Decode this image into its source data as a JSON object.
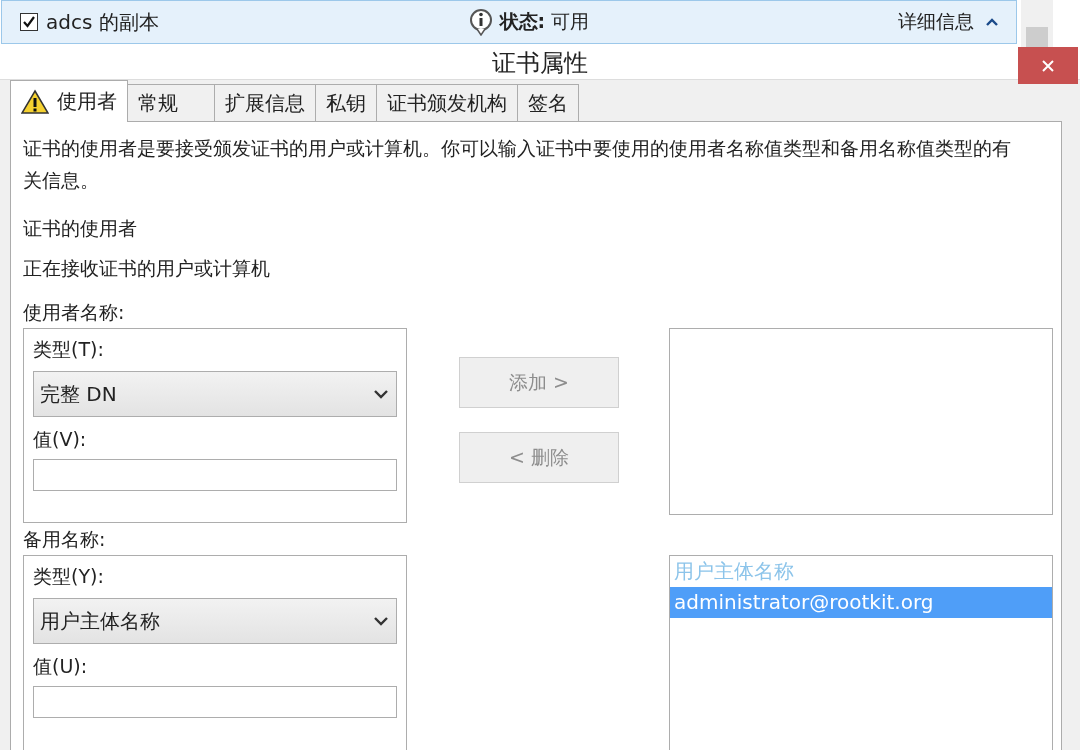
{
  "template_bar": {
    "checked": true,
    "name": "adcs 的副本",
    "status_label": "状态:",
    "status_value": "可用",
    "details": "详细信息"
  },
  "window": {
    "title": "证书属性"
  },
  "tabs": [
    {
      "label": "使用者",
      "selected": true,
      "warning": true
    },
    {
      "label": "常规",
      "selected": false,
      "warning": false
    },
    {
      "label": "扩展信息",
      "selected": false,
      "warning": false
    },
    {
      "label": "私钥",
      "selected": false,
      "warning": false
    },
    {
      "label": "证书颁发机构",
      "selected": false,
      "warning": false
    },
    {
      "label": "签名",
      "selected": false,
      "warning": false
    }
  ],
  "description": "证书的使用者是要接受颁发证书的用户或计算机。你可以输入证书中要使用的使用者名称值类型和备用名称值类型的有关信息。",
  "subject_heading": "证书的使用者",
  "subject_subheading": "正在接收证书的用户或计算机",
  "subject_name": {
    "label": "使用者名称:",
    "type_label": "类型(T):",
    "type_value": "完整 DN",
    "value_label": "值(V):"
  },
  "buttons": [
    {
      "label": "添加 >",
      "disabled": true
    },
    {
      "label": "< 删除",
      "disabled": true
    }
  ],
  "alternative_name": {
    "label": "备用名称:",
    "type_label": "类型(Y):",
    "type_value": "用户主体名称",
    "value_label": "值(U):"
  },
  "alternative_list": [
    {
      "kind": "group",
      "text": "用户主体名称",
      "selected": false
    },
    {
      "kind": "entry",
      "text": "administrator@rootkit.org",
      "selected": true
    }
  ]
}
